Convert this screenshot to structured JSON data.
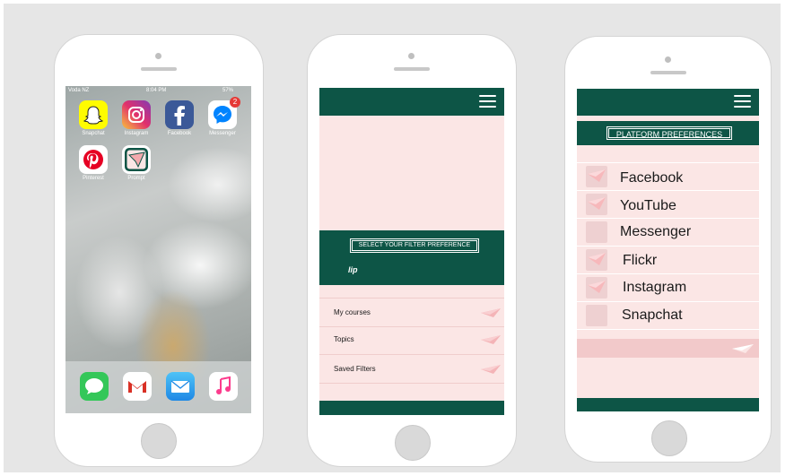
{
  "phone1": {
    "status": {
      "carrier": "Voda NZ",
      "time": "8:04 PM",
      "battery": "57%"
    },
    "apps": [
      {
        "label": "Snapchat",
        "icon": "snapchat-icon",
        "color": "#fffc00"
      },
      {
        "label": "Instagram",
        "icon": "instagram-icon",
        "color": "#c13584"
      },
      {
        "label": "Facebook",
        "icon": "facebook-icon",
        "color": "#3b5998"
      },
      {
        "label": "Messenger",
        "icon": "messenger-icon",
        "color": "#0084ff",
        "badge": "2"
      },
      {
        "label": "Pinterest",
        "icon": "pinterest-icon",
        "color": "#e60023"
      },
      {
        "label": "Prompt",
        "icon": "prompt-icon",
        "color": "#0d5546"
      }
    ],
    "dock": [
      {
        "icon": "messages-icon",
        "color": "#34c759"
      },
      {
        "icon": "gmail-icon",
        "color": "#ffffff"
      },
      {
        "icon": "mail-icon",
        "color": "#1e88e5"
      },
      {
        "icon": "music-icon",
        "color": "#ffffff"
      }
    ]
  },
  "phone2": {
    "filter_button": "SELECT YOUR FILTER PREFERENCE",
    "logo_text": "lip",
    "menu": [
      "My courses",
      "Topics",
      "Saved Filters"
    ]
  },
  "phone3": {
    "title": "PLATFORM PREFERENCES",
    "platforms": [
      {
        "name": "Facebook",
        "checked": true
      },
      {
        "name": "YouTube",
        "checked": true
      },
      {
        "name": "Messenger",
        "checked": false
      },
      {
        "name": "Flickr",
        "checked": true
      },
      {
        "name": "Instagram",
        "checked": true
      },
      {
        "name": "Snapchat",
        "checked": false
      }
    ]
  },
  "colors": {
    "primary": "#0d5546",
    "pink": "#fbe6e5",
    "accent": "#f4a9ad"
  }
}
